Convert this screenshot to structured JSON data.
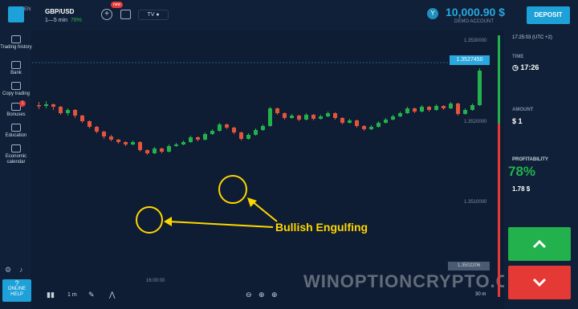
{
  "header": {
    "logo_text": "EN",
    "asset": "GBP/USD",
    "duration": "1—5 min",
    "payout": "78%",
    "new_badge": "new",
    "balance": "10,000.90 $",
    "account_type": "DEMO ACCOUNT",
    "deposit_label": "DEPOSIT",
    "avatar_letter": "Y"
  },
  "sidebar": {
    "items": [
      {
        "label": "Trading history"
      },
      {
        "label": "Bank"
      },
      {
        "label": "Copy trading"
      },
      {
        "label": "Bonuses",
        "badge": "1"
      },
      {
        "label": "Education"
      },
      {
        "label": "Economic calendar"
      }
    ],
    "help_label": "ONLINE HELP",
    "help_q": "?"
  },
  "chart": {
    "current_price": "1.3527450",
    "low_price": "1.3502206",
    "y_labels": [
      "1.3530000",
      "1.3520000",
      "1.3510000"
    ],
    "x_label": "16:00:00",
    "timeframe": "1 m",
    "zoom_label": "30 m",
    "annotation": "Bullish Engulfing"
  },
  "right_panel": {
    "clock": "17:25:03 (UTC +2)",
    "time_label": "TIME",
    "time_value": "17:26",
    "amount_label": "AMOUNT",
    "amount_value": "$ 1",
    "profit_label": "PROFITABILITY",
    "profit_pct": "78%",
    "profit_value": "1.78 $"
  },
  "watermark": "WINOPTIONCRYPTO.COM",
  "chart_data": {
    "type": "candlestick",
    "candles": [
      [
        1.35232,
        1.35231,
        1.35236,
        1.35227
      ],
      [
        1.35231,
        1.35233,
        1.35237,
        1.35228
      ],
      [
        1.35233,
        1.3523,
        1.35234,
        1.35226
      ],
      [
        1.3523,
        1.35222,
        1.35231,
        1.3522
      ],
      [
        1.35222,
        1.35226,
        1.35228,
        1.35219
      ],
      [
        1.35226,
        1.35219,
        1.35227,
        1.35216
      ],
      [
        1.35219,
        1.35212,
        1.3522,
        1.3521
      ],
      [
        1.35212,
        1.35205,
        1.35213,
        1.35203
      ],
      [
        1.35205,
        1.35199,
        1.35206,
        1.35197
      ],
      [
        1.35199,
        1.35193,
        1.352,
        1.3519
      ],
      [
        1.35193,
        1.35189,
        1.35195,
        1.35187
      ],
      [
        1.35189,
        1.35186,
        1.3519,
        1.35184
      ],
      [
        1.35186,
        1.35183,
        1.35187,
        1.35181
      ],
      [
        1.35183,
        1.35186,
        1.35188,
        1.35182
      ],
      [
        1.35186,
        1.35176,
        1.35187,
        1.35174
      ],
      [
        1.35176,
        1.35172,
        1.35177,
        1.3517
      ],
      [
        1.35172,
        1.35178,
        1.3518,
        1.35171
      ],
      [
        1.35178,
        1.35174,
        1.35179,
        1.35172
      ],
      [
        1.35174,
        1.35181,
        1.35183,
        1.35173
      ],
      [
        1.35181,
        1.35183,
        1.35185,
        1.3518
      ],
      [
        1.35183,
        1.35186,
        1.35188,
        1.35182
      ],
      [
        1.35186,
        1.35192,
        1.35194,
        1.35185
      ],
      [
        1.35192,
        1.35189,
        1.35193,
        1.35187
      ],
      [
        1.35189,
        1.35196,
        1.35198,
        1.35188
      ],
      [
        1.35196,
        1.352,
        1.35202,
        1.35195
      ],
      [
        1.352,
        1.35208,
        1.3521,
        1.35199
      ],
      [
        1.35208,
        1.35204,
        1.35209,
        1.35202
      ],
      [
        1.35204,
        1.35198,
        1.35205,
        1.35196
      ],
      [
        1.35198,
        1.3519,
        1.35199,
        1.35188
      ],
      [
        1.3519,
        1.35195,
        1.35197,
        1.35189
      ],
      [
        1.35195,
        1.35201,
        1.35203,
        1.35194
      ],
      [
        1.35201,
        1.35206,
        1.35208,
        1.352
      ],
      [
        1.35206,
        1.35228,
        1.3523,
        1.35205
      ],
      [
        1.35228,
        1.35222,
        1.35229,
        1.3522
      ],
      [
        1.35222,
        1.35216,
        1.35223,
        1.35214
      ],
      [
        1.35216,
        1.35219,
        1.35221,
        1.35215
      ],
      [
        1.35219,
        1.35214,
        1.3522,
        1.35212
      ],
      [
        1.35214,
        1.3522,
        1.35222,
        1.35213
      ],
      [
        1.3522,
        1.35215,
        1.35221,
        1.35213
      ],
      [
        1.35215,
        1.35218,
        1.3522,
        1.35214
      ],
      [
        1.35218,
        1.35222,
        1.35224,
        1.35217
      ],
      [
        1.35222,
        1.35216,
        1.35223,
        1.35214
      ],
      [
        1.35216,
        1.3521,
        1.35217,
        1.35208
      ],
      [
        1.3521,
        1.35213,
        1.35215,
        1.35209
      ],
      [
        1.35213,
        1.35206,
        1.35214,
        1.35204
      ],
      [
        1.35206,
        1.35202,
        1.35207,
        1.352
      ],
      [
        1.35202,
        1.35205,
        1.35207,
        1.35201
      ],
      [
        1.35205,
        1.3521,
        1.35212,
        1.35204
      ],
      [
        1.3521,
        1.35214,
        1.35216,
        1.35209
      ],
      [
        1.35214,
        1.35218,
        1.3522,
        1.35213
      ],
      [
        1.35218,
        1.35222,
        1.35224,
        1.35217
      ],
      [
        1.35222,
        1.35228,
        1.3523,
        1.35221
      ],
      [
        1.35228,
        1.35224,
        1.35229,
        1.35222
      ],
      [
        1.35224,
        1.3523,
        1.35232,
        1.35223
      ],
      [
        1.3523,
        1.35226,
        1.35231,
        1.35224
      ],
      [
        1.35226,
        1.35231,
        1.35233,
        1.35225
      ],
      [
        1.35231,
        1.35228,
        1.35232,
        1.35226
      ],
      [
        1.35228,
        1.35234,
        1.35236,
        1.35227
      ],
      [
        1.35234,
        1.35221,
        1.35235,
        1.35219
      ],
      [
        1.35221,
        1.35226,
        1.35228,
        1.3522
      ],
      [
        1.35226,
        1.35232,
        1.35234,
        1.35225
      ],
      [
        1.35232,
        1.35275,
        1.35278,
        1.35231
      ]
    ],
    "ylim": [
      1.3502,
      1.3532
    ],
    "current": 1.352745
  }
}
